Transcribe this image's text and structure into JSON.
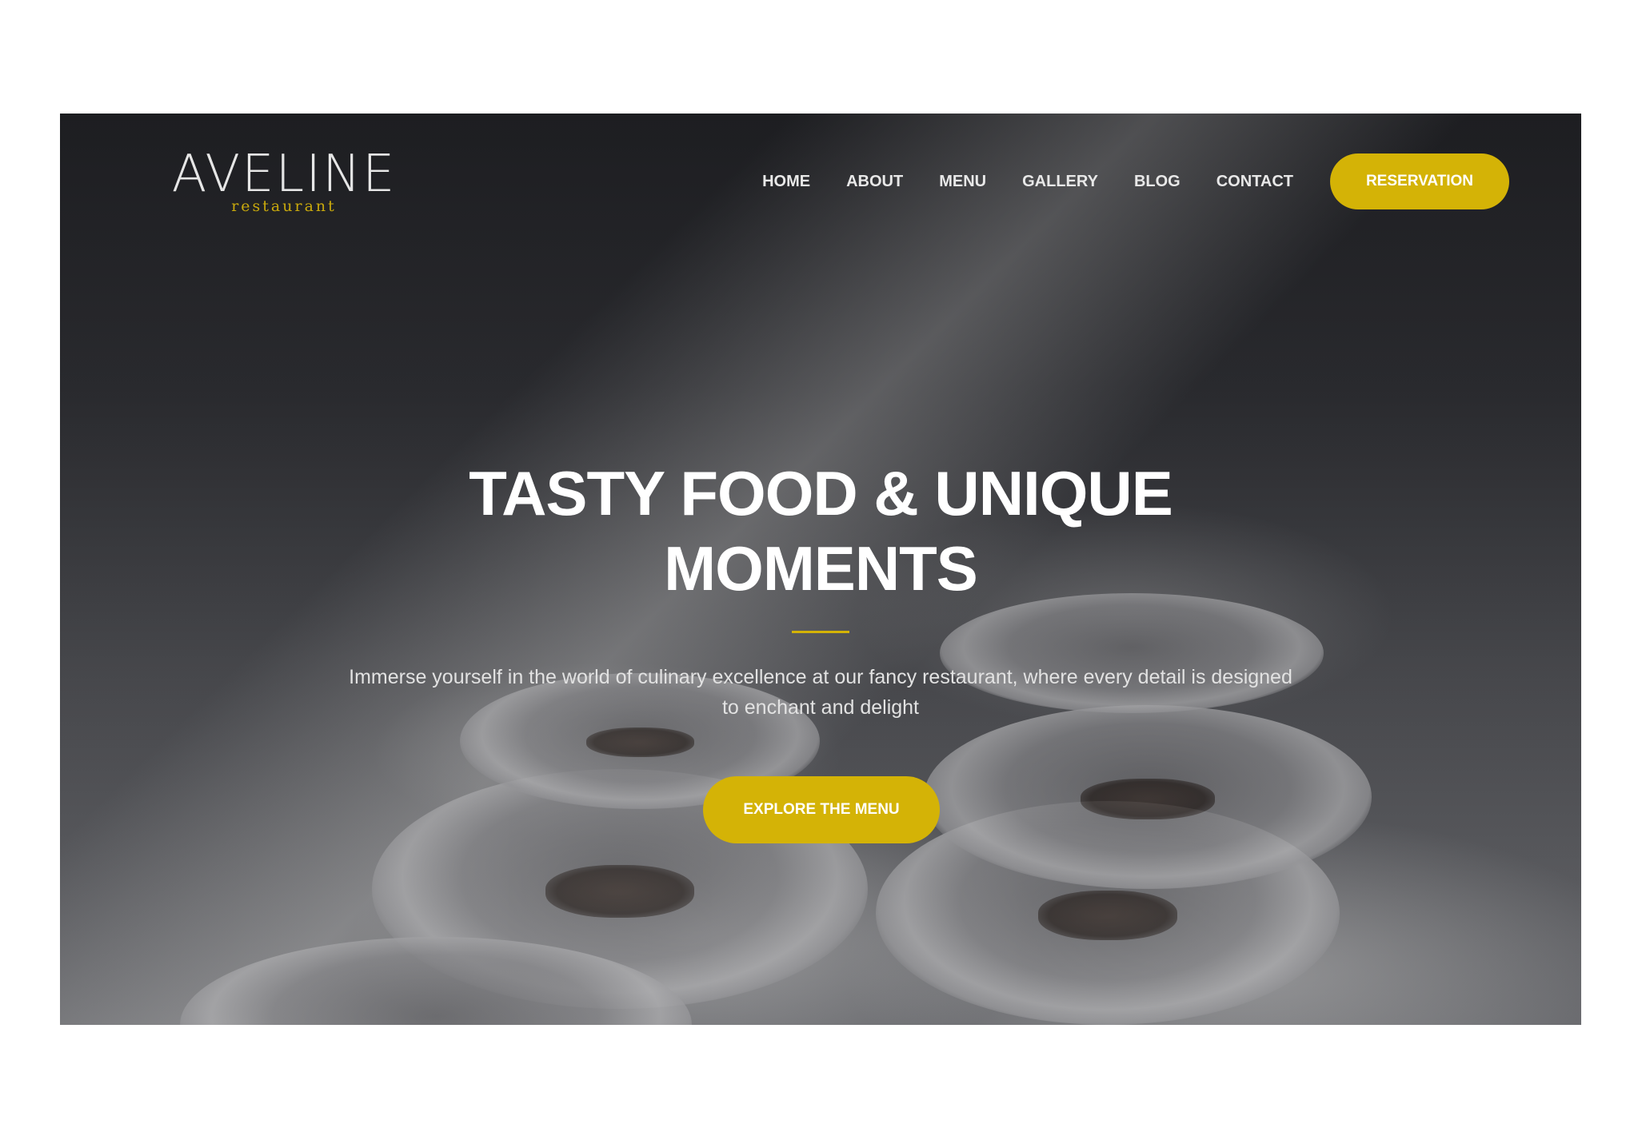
{
  "brand": {
    "name": "AVELINE",
    "tagline": "restaurant",
    "accent_color": "#d4b306"
  },
  "nav": {
    "items": [
      {
        "label": "HOME"
      },
      {
        "label": "ABOUT"
      },
      {
        "label": "MENU"
      },
      {
        "label": "GALLERY"
      },
      {
        "label": "BLOG"
      },
      {
        "label": "CONTACT"
      }
    ],
    "cta_label": "RESERVATION"
  },
  "hero": {
    "headline_line1": "TASTY FOOD & UNIQUE",
    "headline_line2": "MOMENTS",
    "description": "Immerse yourself in the world of culinary excellence at our fancy restaurant, where every detail is designed to enchant and delight",
    "cta_label": "EXPLORE THE MENU",
    "background_image": "chef plating dishes in kitchen"
  }
}
